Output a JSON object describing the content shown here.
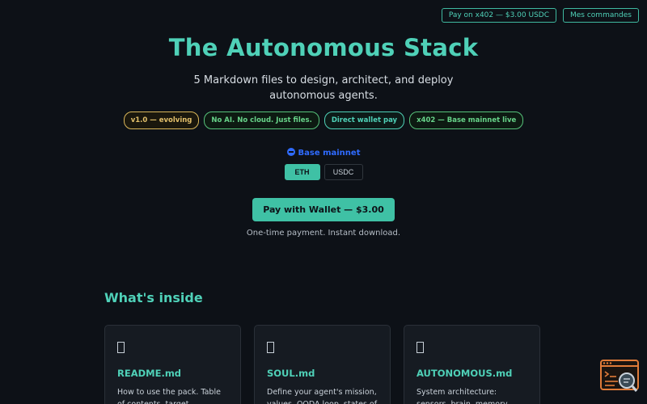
{
  "header": {
    "pay_x402_label": "Pay on x402 — $3.00 USDC",
    "orders_label": "Mes commandes"
  },
  "hero": {
    "title": "The Autonomous Stack",
    "subtitle": "5 Markdown files to design, architect, and deploy autonomous agents."
  },
  "badges": [
    {
      "label": "v1.0 — evolving"
    },
    {
      "label": "No AI. No cloud. Just files."
    },
    {
      "label": "Direct wallet pay"
    },
    {
      "label": "x402 — Base mainnet live"
    }
  ],
  "network": {
    "label": "Base mainnet",
    "icon": "base-network-icon",
    "color": "#2f6bff"
  },
  "tokens": {
    "options": [
      "ETH",
      "USDC"
    ],
    "selected": "ETH"
  },
  "payment": {
    "button_label": "Pay with Wallet — $3.00",
    "note": "One-time payment. Instant download."
  },
  "inside": {
    "title": "What's inside",
    "cards": [
      {
        "icon": "document-icon",
        "title": "README.md",
        "description": "How to use the pack. Table of contents, target audience, and"
      },
      {
        "icon": "document-icon",
        "title": "SOUL.md",
        "description": "Define your agent's mission, values, OODA loop, states of"
      },
      {
        "icon": "document-icon",
        "title": "AUTONOMOUS.md",
        "description": "System architecture: sensors, brain, memory, actuators,"
      }
    ]
  },
  "colors": {
    "accent": "#4fd1b8",
    "background": "#0d1117",
    "card_bg": "#161b22",
    "version_badge": "#e3c06b",
    "green_badge": "#67d389",
    "widget_orange": "#e07b39"
  }
}
